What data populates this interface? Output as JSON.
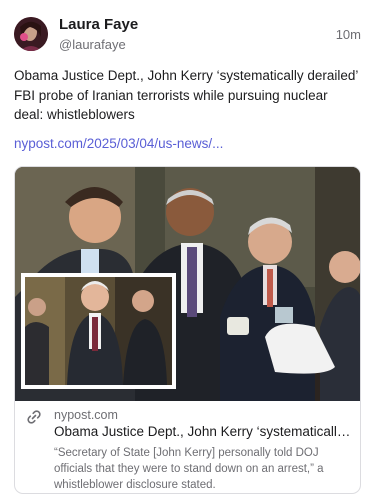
{
  "author": {
    "name": "Laura Faye",
    "handle": "@laurafaye"
  },
  "post": {
    "timestamp": "10m",
    "text": "Obama Justice Dept., John Kerry ‘systematically derailed’ FBI probe of Iranian terrorists while pursuing nuclear deal: whistleblowers",
    "link_text": "nypost.com/2025/03/04/us-news/..."
  },
  "link_card": {
    "domain": "nypost.com",
    "title": "Obama Justice Dept., John Kerry ‘systematically derailed’ FBI probe of Iranian terrorists while pursuing nuclear deal: whistleblowers",
    "description": "“Secretary of State [John Kerry] personally told DOJ officials that they were to stand down on an arrest,” a whistleblower disclosure stated.",
    "icon": "link-icon"
  },
  "colors": {
    "link": "#5a5fd6",
    "muted": "#6e6e73",
    "text": "#1c1c1e",
    "border": "#dcdce0"
  }
}
